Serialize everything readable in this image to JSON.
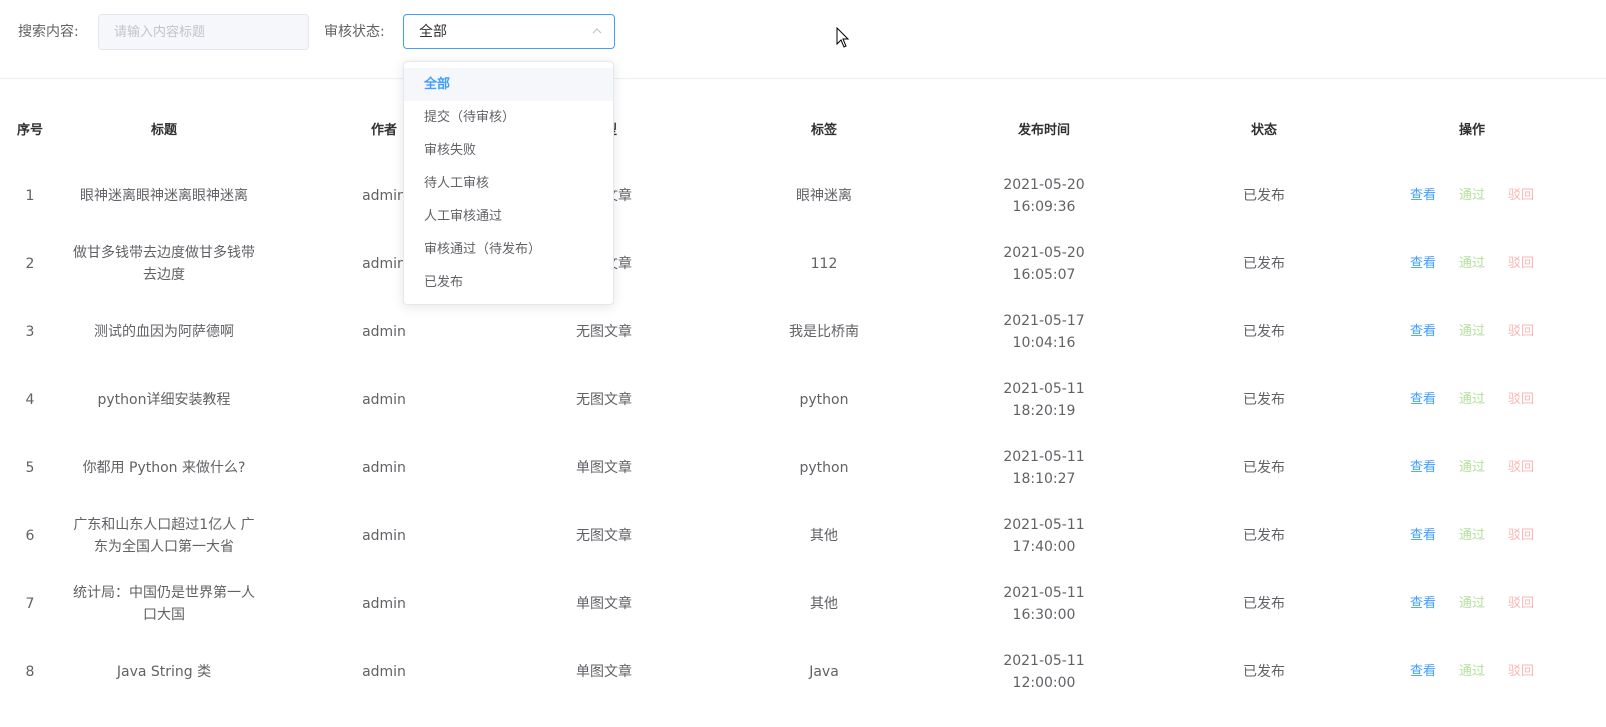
{
  "filters": {
    "search_label": "搜索内容:",
    "search_placeholder": "请输入内容标题",
    "status_label": "审核状态:",
    "status_value": "全部"
  },
  "dropdown": {
    "options": [
      "全部",
      "提交（待审核）",
      "审核失败",
      "待人工审核",
      "人工审核通过",
      "审核通过（待发布）",
      "已发布"
    ]
  },
  "table": {
    "headers": {
      "index": "序号",
      "title": "标题",
      "author": "作者",
      "type": "类型",
      "tag": "标签",
      "time": "发布时间",
      "status": "状态",
      "ops": "操作"
    },
    "op_labels": {
      "view": "查看",
      "pass": "通过",
      "reject": "驳回"
    },
    "rows": [
      {
        "index": "1",
        "title": "眼神迷离眼神迷离眼神迷离",
        "author": "admin",
        "type": "无图文章",
        "tag": "眼神迷离",
        "date": "2021-05-20",
        "time": "16:09:36",
        "status": "已发布"
      },
      {
        "index": "2",
        "title": "做甘多钱带去边度做甘多钱带去边度",
        "author": "admin",
        "type": "无图文章",
        "tag": "112",
        "date": "2021-05-20",
        "time": "16:05:07",
        "status": "已发布"
      },
      {
        "index": "3",
        "title": "测试的血因为阿萨德啊",
        "author": "admin",
        "type": "无图文章",
        "tag": "我是比桥南",
        "date": "2021-05-17",
        "time": "10:04:16",
        "status": "已发布"
      },
      {
        "index": "4",
        "title": "python详细安装教程",
        "author": "admin",
        "type": "无图文章",
        "tag": "python",
        "date": "2021-05-11",
        "time": "18:20:19",
        "status": "已发布"
      },
      {
        "index": "5",
        "title": "你都用 Python 来做什么?",
        "author": "admin",
        "type": "单图文章",
        "tag": "python",
        "date": "2021-05-11",
        "time": "18:10:27",
        "status": "已发布"
      },
      {
        "index": "6",
        "title": "广东和山东人口超过1亿人 广东为全国人口第一大省",
        "author": "admin",
        "type": "无图文章",
        "tag": "其他",
        "date": "2021-05-11",
        "time": "17:40:00",
        "status": "已发布"
      },
      {
        "index": "7",
        "title": "统计局：中国仍是世界第一人口大国",
        "author": "admin",
        "type": "单图文章",
        "tag": "其他",
        "date": "2021-05-11",
        "time": "16:30:00",
        "status": "已发布"
      },
      {
        "index": "8",
        "title": "Java String 类",
        "author": "admin",
        "type": "单图文章",
        "tag": "Java",
        "date": "2021-05-11",
        "time": "12:00:00",
        "status": "已发布"
      }
    ]
  }
}
